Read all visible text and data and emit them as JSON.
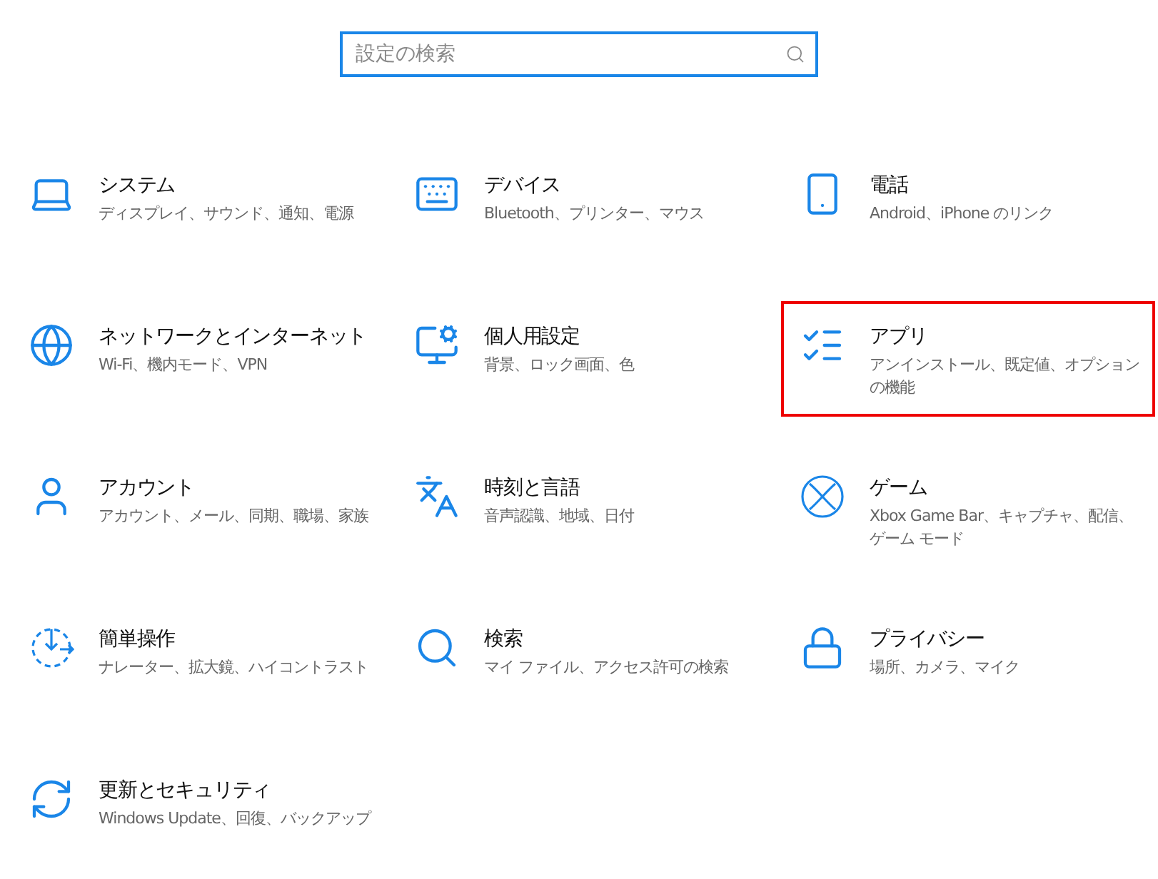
{
  "search": {
    "placeholder": "設定の検索"
  },
  "items": [
    {
      "title": "システム",
      "description": "ディスプレイ、サウンド、通知、電源",
      "highlighted": false
    },
    {
      "title": "デバイス",
      "description": "Bluetooth、プリンター、マウス",
      "highlighted": false
    },
    {
      "title": "電話",
      "description": "Android、iPhone のリンク",
      "highlighted": false
    },
    {
      "title": "ネットワークとインターネット",
      "description": "Wi-Fi、機内モード、VPN",
      "highlighted": false
    },
    {
      "title": "個人用設定",
      "description": "背景、ロック画面、色",
      "highlighted": false
    },
    {
      "title": "アプリ",
      "description": "アンインストール、既定値、オプションの機能",
      "highlighted": true
    },
    {
      "title": "アカウント",
      "description": "アカウント、メール、同期、職場、家族",
      "highlighted": false
    },
    {
      "title": "時刻と言語",
      "description": "音声認識、地域、日付",
      "highlighted": false
    },
    {
      "title": "ゲーム",
      "description": "Xbox Game Bar、キャプチャ、配信、ゲーム モード",
      "highlighted": false
    },
    {
      "title": "簡単操作",
      "description": "ナレーター、拡大鏡、ハイコントラスト",
      "highlighted": false
    },
    {
      "title": "検索",
      "description": "マイ ファイル、アクセス許可の検索",
      "highlighted": false
    },
    {
      "title": "プライバシー",
      "description": "場所、カメラ、マイク",
      "highlighted": false
    },
    {
      "title": "更新とセキュリティ",
      "description": "Windows Update、回復、バックアップ",
      "highlighted": false
    }
  ]
}
